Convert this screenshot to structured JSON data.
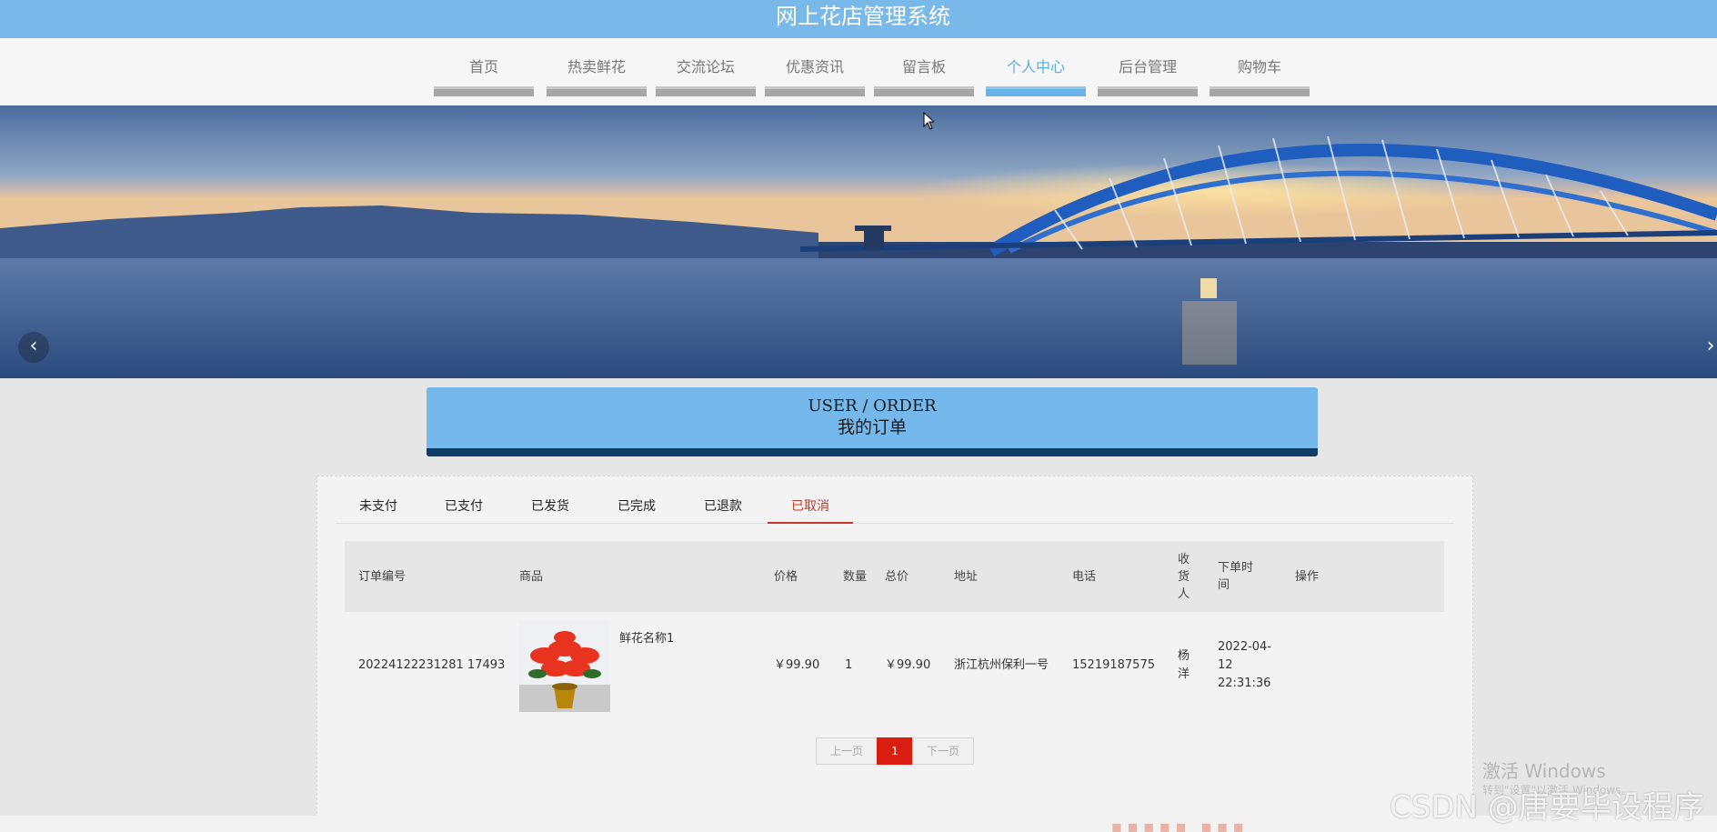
{
  "site": {
    "title": "网上花店管理系统"
  },
  "nav": {
    "items": [
      {
        "label": "首页"
      },
      {
        "label": "热卖鲜花"
      },
      {
        "label": "交流论坛"
      },
      {
        "label": "优惠资讯"
      },
      {
        "label": "留言板"
      },
      {
        "label": "个人中心",
        "active": true
      },
      {
        "label": "后台管理"
      },
      {
        "label": "购物车"
      }
    ]
  },
  "banner": {
    "prev_icon": "chevron-left-icon",
    "next_icon": "chevron-right-icon",
    "prev_glyph": "‹",
    "next_glyph": "›"
  },
  "section": {
    "title_en": "USER / ORDER",
    "title_zh": "我的订单"
  },
  "tabs": [
    {
      "label": "未支付"
    },
    {
      "label": "已支付"
    },
    {
      "label": "已发货"
    },
    {
      "label": "已完成"
    },
    {
      "label": "已退款"
    },
    {
      "label": "已取消",
      "active": true
    }
  ],
  "table": {
    "headers": [
      "订单编号",
      "商品",
      "价格",
      "数量",
      "总价",
      "地址",
      "电话",
      "收货人",
      "下单时间",
      "操作"
    ],
    "rows": [
      {
        "order_no": "20224122231281 17493",
        "product_name": "鲜花名称1",
        "price": "￥99.90",
        "quantity": "1",
        "total": "￥99.90",
        "address": "浙江杭州保利一号",
        "phone": "15219187575",
        "receiver": "杨洋",
        "time": "2022-04-12 22:31:36",
        "action": ""
      }
    ]
  },
  "pager": {
    "prev": "上一页",
    "current": "1",
    "next": "下一页"
  },
  "watermarks": {
    "windows": "激活 Windows",
    "windows_sub": "转到\"设置\"以激活 Windows。",
    "csdn": "CSDN @唐要毕设程序"
  },
  "colors": {
    "header": "#78b9ea",
    "active_nav": "#5aaee8",
    "accent_red": "#d91e0f",
    "section_bar": "#103d67"
  }
}
